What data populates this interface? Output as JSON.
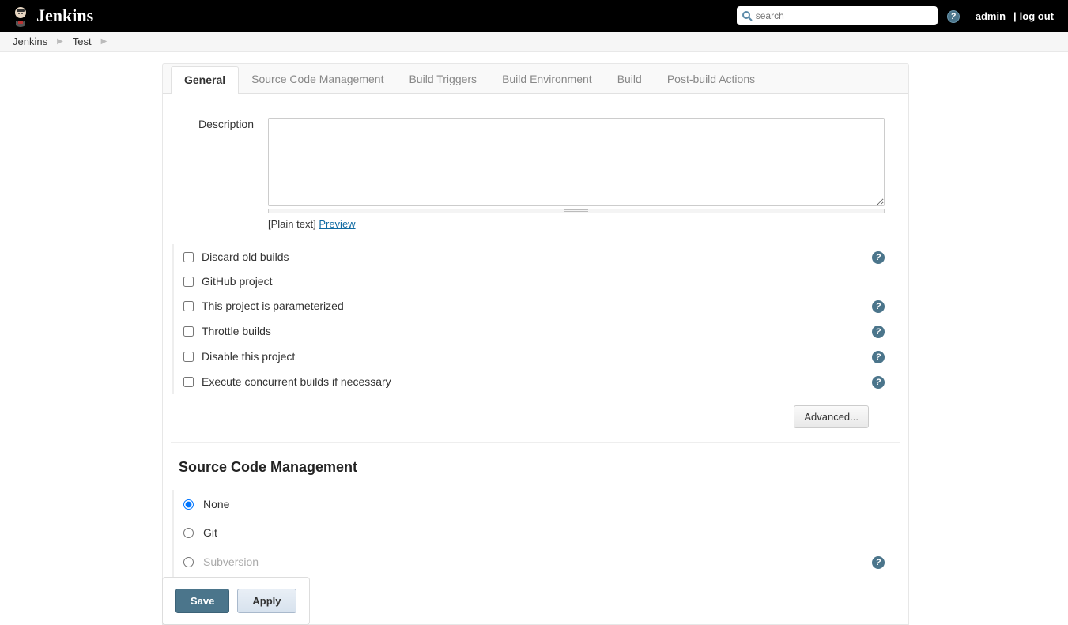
{
  "header": {
    "brand": "Jenkins",
    "search_placeholder": "search",
    "user": "admin",
    "logout": "log out"
  },
  "breadcrumb": [
    "Jenkins",
    "Test"
  ],
  "tabs": [
    {
      "label": "General",
      "active": true
    },
    {
      "label": "Source Code Management",
      "active": false
    },
    {
      "label": "Build Triggers",
      "active": false
    },
    {
      "label": "Build Environment",
      "active": false
    },
    {
      "label": "Build",
      "active": false
    },
    {
      "label": "Post-build Actions",
      "active": false
    }
  ],
  "general": {
    "description_label": "Description",
    "description_value": "",
    "plain_text": "[Plain text]",
    "preview": "Preview",
    "options": [
      {
        "label": "Discard old builds",
        "checked": false,
        "help": true
      },
      {
        "label": "GitHub project",
        "checked": false,
        "help": false
      },
      {
        "label": "This project is parameterized",
        "checked": false,
        "help": true
      },
      {
        "label": "Throttle builds",
        "checked": false,
        "help": true
      },
      {
        "label": "Disable this project",
        "checked": false,
        "help": true
      },
      {
        "label": "Execute concurrent builds if necessary",
        "checked": false,
        "help": true
      }
    ],
    "advanced": "Advanced..."
  },
  "scm": {
    "title": "Source Code Management",
    "options": [
      {
        "label": "None",
        "selected": true,
        "help": false,
        "faded": false
      },
      {
        "label": "Git",
        "selected": false,
        "help": false,
        "faded": false
      },
      {
        "label": "Subversion",
        "selected": false,
        "help": true,
        "faded": true
      }
    ]
  },
  "buttons": {
    "save": "Save",
    "apply": "Apply"
  }
}
